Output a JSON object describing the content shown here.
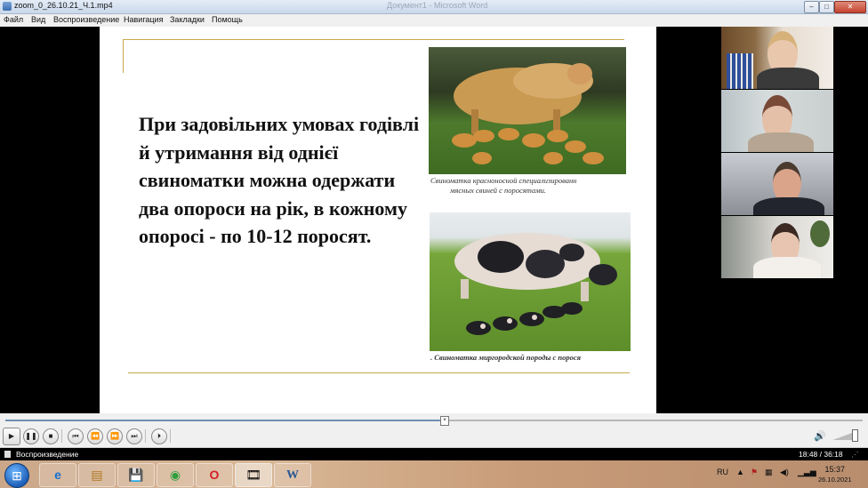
{
  "window": {
    "title": "zoom_0_26.10.21_Ч.1.mp4",
    "ghost_title": "Документ1 - Microsoft Word",
    "min_glyph": "–",
    "max_glyph": "□",
    "close_glyph": "✕"
  },
  "menu": [
    "Файл",
    "Вид",
    "Воспроизведение",
    "Навигация",
    "Закладки",
    "Помощь"
  ],
  "slide": {
    "text": "При задовільних умовах годівлі й утримання від однієї свиноматки можна одержати два опороси на рік, в кожному опоросі - по 10-12 поросят.",
    "caption1_line1": "Свиноматка красноносной специализированн",
    "caption1_line2": "мясных свиней с поросятами.",
    "caption2": ". Свиноматка миргородской породы с порося"
  },
  "player": {
    "progress_fraction": 0.512,
    "buttons": {
      "play": "▶",
      "pause": "❚❚",
      "stop": "■",
      "prev_chapter": "⏮",
      "rewind": "⏪",
      "forward": "⏩",
      "next_chapter": "⏭",
      "frame_step": "⏵"
    },
    "volume_icon": "🔊"
  },
  "status": {
    "state": "Воспроизведение",
    "time": "18:48 / 36:18",
    "grip": "⋰"
  },
  "taskbar": {
    "start_glyph": "⊞",
    "apps": [
      {
        "name": "ie-icon",
        "glyph": "e"
      },
      {
        "name": "explorer-icon",
        "glyph": "▤"
      },
      {
        "name": "save-icon",
        "glyph": "💾"
      },
      {
        "name": "chrome-icon",
        "glyph": "◉"
      },
      {
        "name": "opera-icon",
        "glyph": "O"
      },
      {
        "name": "media-player-icon",
        "glyph": "🎞"
      },
      {
        "name": "word-icon",
        "glyph": "W"
      }
    ],
    "lang": "RU",
    "clock_time": "15:37",
    "clock_date": "26.10.2021"
  },
  "colors": {
    "accent_rule": "#c9a84a",
    "word_blue": "#2b5797"
  }
}
